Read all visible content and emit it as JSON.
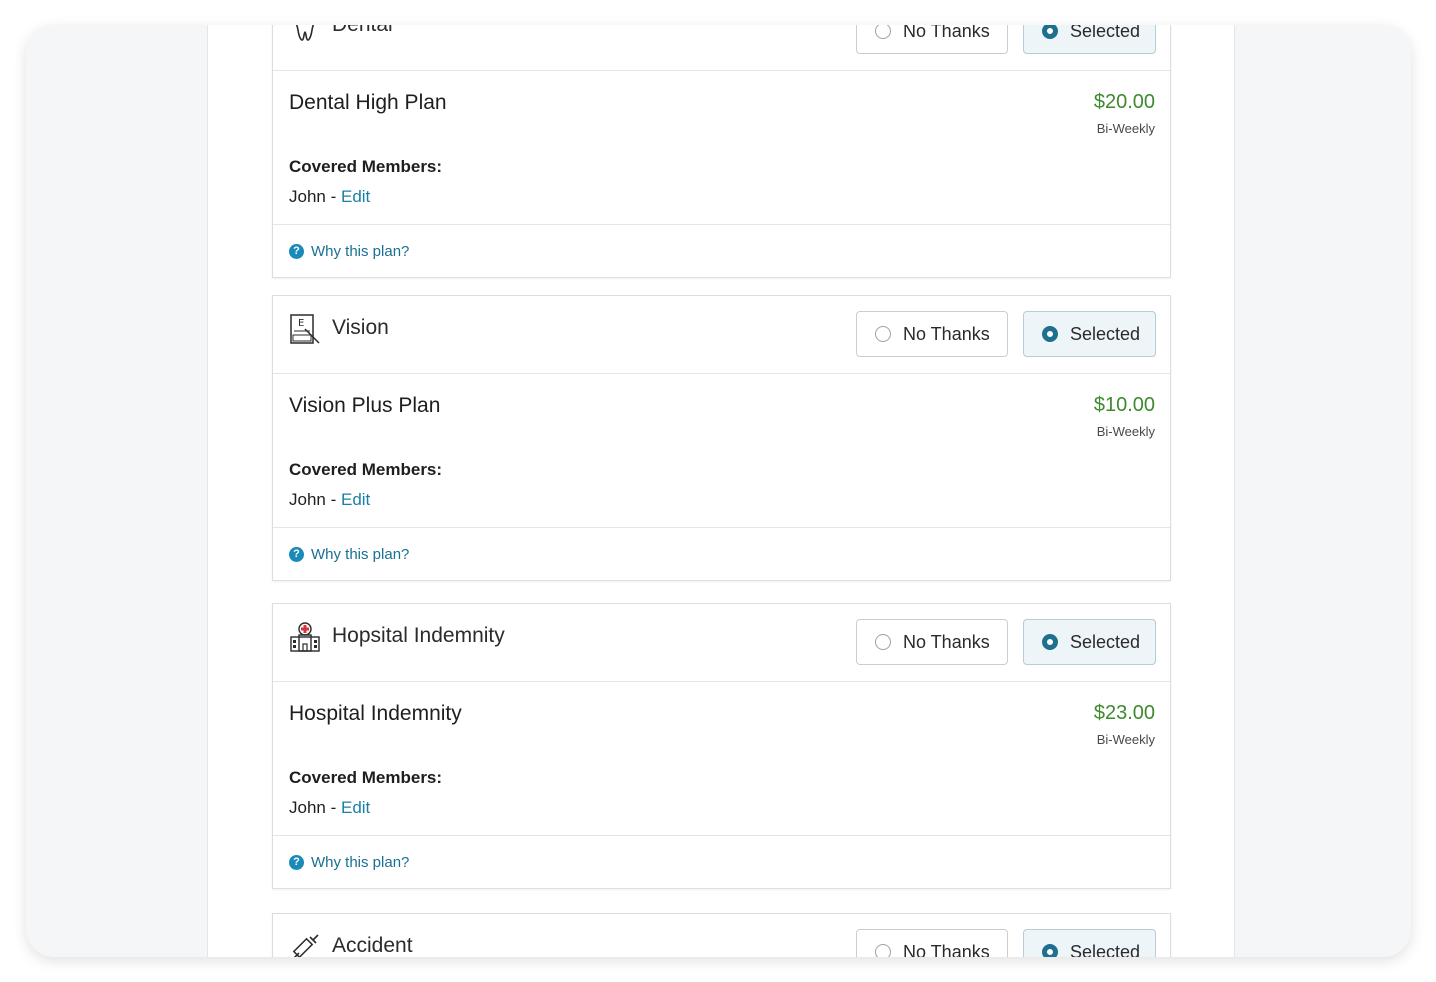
{
  "options": {
    "no_thanks": "No Thanks",
    "selected": "Selected"
  },
  "labels": {
    "covered_members": "Covered Members:",
    "why": "Why this plan?",
    "edit": "Edit",
    "help_glyph": "?"
  },
  "colors": {
    "price": "#3e8a2e",
    "link": "#1a7fa8",
    "radio_selected": "#1f6f8f"
  },
  "cards": [
    {
      "category": "Dental",
      "icon": "tooth-icon",
      "plan": "Dental High Plan",
      "price": "$20.00",
      "period": "Bi-Weekly",
      "members": "John - "
    },
    {
      "category": "Vision",
      "icon": "eye-chart-icon",
      "plan": "Vision Plus Plan",
      "price": "$10.00",
      "period": "Bi-Weekly",
      "members": "John - "
    },
    {
      "category": "Hopsital Indemnity",
      "icon": "hospital-icon",
      "plan": "Hospital Indemnity",
      "price": "$23.00",
      "period": "Bi-Weekly",
      "members": "John - "
    },
    {
      "category": "Accident",
      "icon": "syringe-icon"
    }
  ]
}
